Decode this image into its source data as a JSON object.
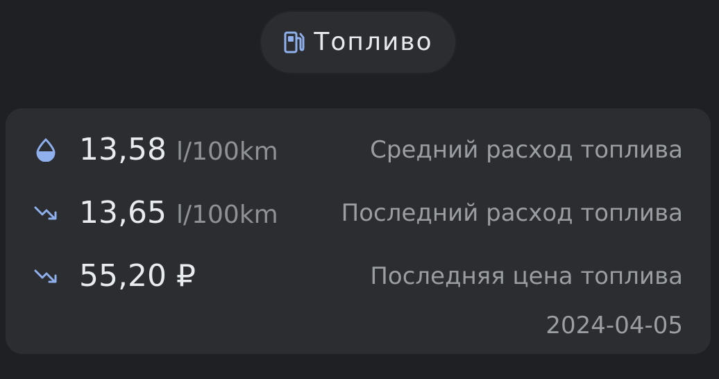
{
  "header": {
    "title": "Топливо",
    "icon": "fuel-pump-icon"
  },
  "metrics": [
    {
      "icon": "water-drop-icon",
      "value": "13,58",
      "unit": "l/100km",
      "label": "Средний расход топлива"
    },
    {
      "icon": "trending-down-icon",
      "value": "13,65",
      "unit": "l/100km",
      "label": "Последний расход топлива"
    },
    {
      "icon": "trending-down-icon",
      "value": "55,20",
      "unit": "₽",
      "label": "Последняя цена топлива"
    }
  ],
  "updated": "2024-04-05",
  "colors": {
    "background": "#1f2024",
    "card": "#2b2d31",
    "icon_accent": "#8fb0ec",
    "value_text": "#e9ecef",
    "muted_text": "#9a9ea3"
  }
}
